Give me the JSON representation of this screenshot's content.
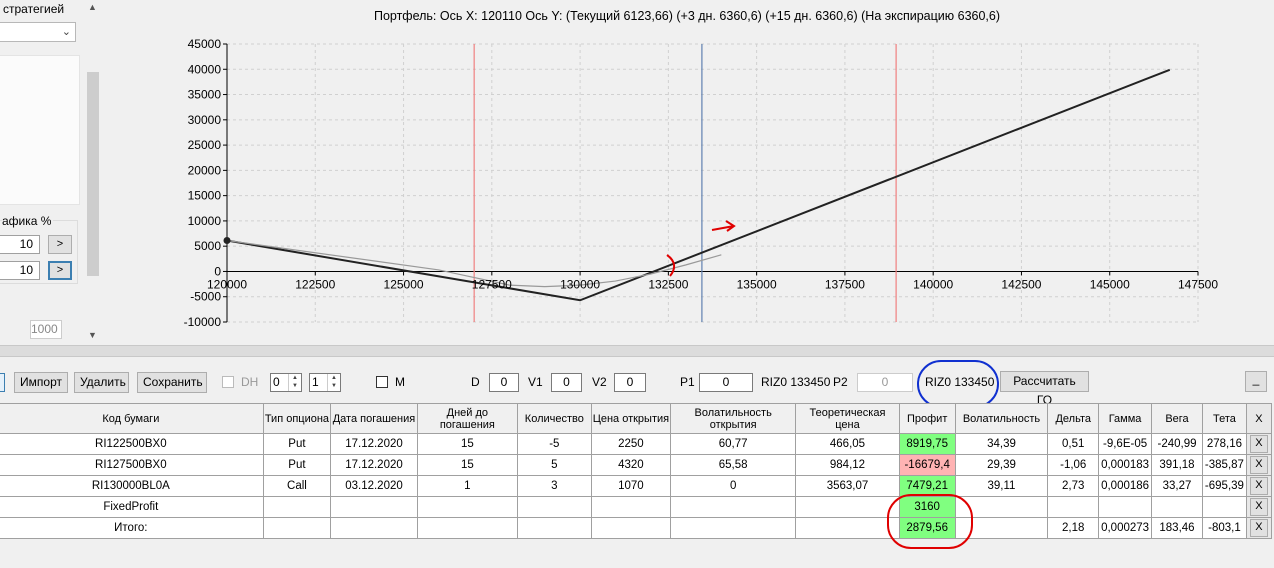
{
  "left_panel": {
    "strategies_label": "стратегией",
    "chart_label": "афика %",
    "input_1": "10",
    "input_2": "10",
    "button_label": ">",
    "disabled_input": "1000"
  },
  "chart": {
    "title": "Портфель: Ось X: 120110 Ось Y:  (Текущий 6123,66)  (+3 дн. 6360,6)  (+15 дн. 6360,6)  (На экспирацию 6360,6)",
    "y_ticks": [
      "45000",
      "40000",
      "35000",
      "30000",
      "25000",
      "20000",
      "15000",
      "10000",
      "5000",
      "0",
      "-5000",
      "-10000"
    ],
    "x_ticks": [
      "120000",
      "122500",
      "125000",
      "127500",
      "130000",
      "132500",
      "135000",
      "137500",
      "140000",
      "142500",
      "145000",
      "147500"
    ]
  },
  "chart_data": {
    "type": "line",
    "xlim": [
      120000,
      147500
    ],
    "ylim": [
      -10000,
      45000
    ],
    "grid": true,
    "series": [
      {
        "name": "На экспирацию",
        "color": "#222222",
        "x": [
          120000,
          130000,
          146700
        ],
        "y": [
          6123,
          -5700,
          39900
        ]
      },
      {
        "name": "Текущий",
        "color": "#999999",
        "x": [
          120000,
          126000,
          128000,
          129000,
          130000,
          131000,
          132000,
          133000,
          134000
        ],
        "y": [
          6123,
          300,
          -2700,
          -3000,
          -2700,
          -1900,
          -500,
          1300,
          3300
        ]
      }
    ],
    "vertical_lines": [
      {
        "x": 127000,
        "color": "#f08080"
      },
      {
        "x": 133450,
        "color": "#6080b0"
      },
      {
        "x": 138950,
        "color": "#f08080"
      }
    ],
    "marker": {
      "x": 120000,
      "y": 6123
    }
  },
  "toolbar": {
    "import_label": "Импорт",
    "delete_label": "Удалить",
    "save_label": "Сохранить",
    "dh_label": "DH",
    "spin1_value": "0",
    "spin2_value": "1",
    "m_label": "M",
    "d_label": "D",
    "d_value": "0",
    "v1_label": "V1",
    "v1_value": "0",
    "v2_label": "V2",
    "v2_value": "0",
    "p1_label": "P1",
    "p1_value": "0",
    "riz_label": "RIZ0 133450",
    "p2_label": "P2",
    "p2_value": "0",
    "riz_box": "RIZ0 133450",
    "calc_label": "Рассчитать ГО",
    "minimize_label": "_"
  },
  "table": {
    "headers": [
      "Код бумаги",
      "Тип опциона",
      "Дата погашения",
      "Дней до погашения",
      "Количество",
      "Цена открытия",
      "Волатильность открытия",
      "Теоретическая цена",
      "Профит",
      "Волатильность",
      "Дельта",
      "Гамма",
      "Вега",
      "Тета",
      "X"
    ],
    "rows": [
      [
        "RI122500BX0",
        "Put",
        "17.12.2020",
        "15",
        "-5",
        "2250",
        "60,77",
        "466,05",
        "8919,75",
        "34,39",
        "0,51",
        "-9,6E-05",
        "-240,99",
        "278,16",
        "X"
      ],
      [
        "RI127500BX0",
        "Put",
        "17.12.2020",
        "15",
        "5",
        "4320",
        "65,58",
        "984,12",
        "-16679,4",
        "29,39",
        "-1,06",
        "0,000183",
        "391,18",
        "-385,87",
        "X"
      ],
      [
        "RI130000BL0A",
        "Call",
        "03.12.2020",
        "1",
        "3",
        "1070",
        "0",
        "3563,07",
        "7479,21",
        "39,11",
        "2,73",
        "0,000186",
        "33,27",
        "-695,39",
        "X"
      ],
      [
        "FixedProfit",
        "",
        "",
        "",
        "",
        "",
        "",
        "",
        "3160",
        "",
        "",
        "",
        "",
        "",
        "X"
      ],
      [
        "Итого:",
        "",
        "",
        "",
        "",
        "",
        "",
        "",
        "2879,56",
        "",
        "2,18",
        "0,000273",
        "183,46",
        "-803,1",
        "X"
      ]
    ],
    "profit_status": [
      "pos",
      "neg",
      "pos",
      "pos",
      "pos"
    ]
  }
}
